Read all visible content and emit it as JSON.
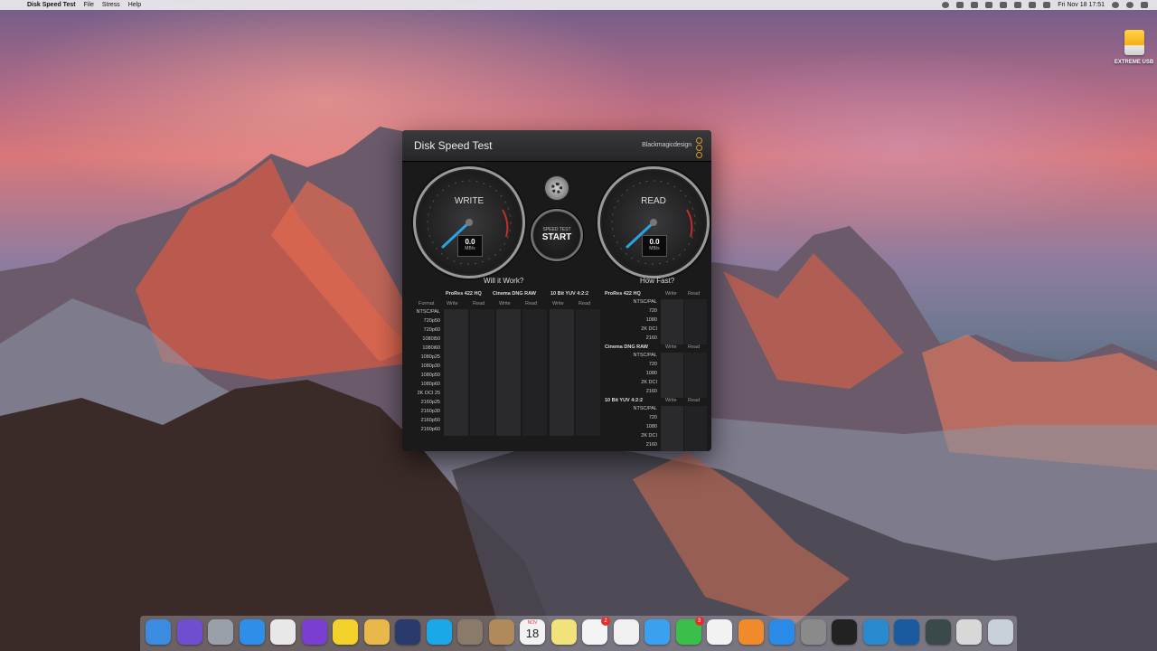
{
  "menubar": {
    "app_name": "Disk Speed Test",
    "menus": [
      "File",
      "Stress",
      "Help"
    ],
    "clock": "Fri Nov 18  17:51"
  },
  "desktop": {
    "drive_label": "EXTREME USB"
  },
  "window": {
    "title": "Disk Speed Test",
    "brand": "Blackmagicdesign",
    "write_gauge": {
      "label": "WRITE",
      "value": "0.0",
      "unit": "MB/s"
    },
    "read_gauge": {
      "label": "READ",
      "value": "0.0",
      "unit": "MB/s"
    },
    "start_button": {
      "small": "SPEED TEST",
      "big": "START"
    },
    "will_it_work": {
      "title": "Will it Work?",
      "format_header": "Format",
      "codecs": [
        "ProRes 422 HQ",
        "Cinema DNG RAW",
        "10 Bit YUV 4:2:2"
      ],
      "col_labels": [
        "Write",
        "Read"
      ],
      "formats": [
        "NTSC/PAL",
        "720p50",
        "720p60",
        "1080i50",
        "1080i60",
        "1080p25",
        "1080p30",
        "1080p50",
        "1080p60",
        "2K DCI 25",
        "2160p25",
        "2160p30",
        "2160p50",
        "2160p60"
      ]
    },
    "how_fast": {
      "title": "How Fast?",
      "col_labels": [
        "Write",
        "Read"
      ],
      "groups": [
        {
          "codec": "ProRes 422 HQ",
          "rows": [
            "NTSC/PAL",
            "720",
            "1080",
            "2K DCI",
            "2160"
          ]
        },
        {
          "codec": "Cinema DNG RAW",
          "rows": [
            "NTSC/PAL",
            "720",
            "1080",
            "2K DCI",
            "2160"
          ]
        },
        {
          "codec": "10 Bit YUV 4:2:2",
          "rows": [
            "NTSC/PAL",
            "720",
            "1080",
            "2K DCI",
            "2160"
          ]
        }
      ]
    }
  },
  "dock": {
    "apps": [
      "finder-icon",
      "siri-icon",
      "launchpad-icon",
      "safari-icon",
      "chrome-icon",
      "phpstorm-icon",
      "cyberduck-icon",
      "sequel-pro-icon",
      "first-aid-icon",
      "skype-icon",
      "notebooks-icon",
      "notefile-icon",
      "calendar-icon",
      "notes-icon",
      "reminders-icon",
      "photos-icon",
      "messages-icon",
      "facetime-icon",
      "itunes-icon",
      "ibooks-icon",
      "app-store-icon",
      "system-preferences-icon",
      "terminal-icon",
      "preview-icon",
      "quicktime-icon",
      "disk-speed-test-icon",
      "screenshot-icon",
      "trash-icon"
    ],
    "calendar_month": "NOV",
    "calendar_day": "18",
    "reminders_badge": "2",
    "facetime_badge": "3"
  }
}
